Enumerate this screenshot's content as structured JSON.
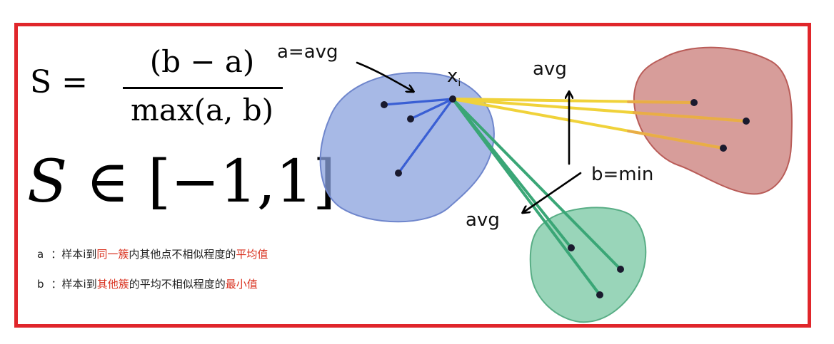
{
  "formula": {
    "s_lhs": "S =",
    "numerator": "(b − a)",
    "denominator": "max(a, b)",
    "range_symbol": "S",
    "range_rest": " ∈ [−1,1]"
  },
  "notes": {
    "a": {
      "prefix": "a",
      "sep": "：",
      "text1": "样本i到",
      "red1": "同一簇",
      "text2": "内其他点不相似程度的",
      "red2": "平均值"
    },
    "b": {
      "prefix": "b",
      "sep": "：",
      "text1": "样本i到",
      "red1": "其他簇",
      "text2": "的平均不相似程度的",
      "red2": "最小值"
    }
  },
  "diagram": {
    "label_a": "a=avg",
    "label_xi": "x",
    "label_xi_sub": "i",
    "label_avg_right": "avg",
    "label_b": "b=min",
    "label_avg_bottom": "avg"
  },
  "colors": {
    "frame": "#e0262b",
    "blue_cluster": "#7f96d9",
    "red_cluster": "#c86a66",
    "green_cluster": "#6ec3a0",
    "intra_lines": "#3a5fd4",
    "red_lines": "#f0d23a",
    "green_lines": "#3aa676",
    "highlight_text": "#d9311f"
  }
}
